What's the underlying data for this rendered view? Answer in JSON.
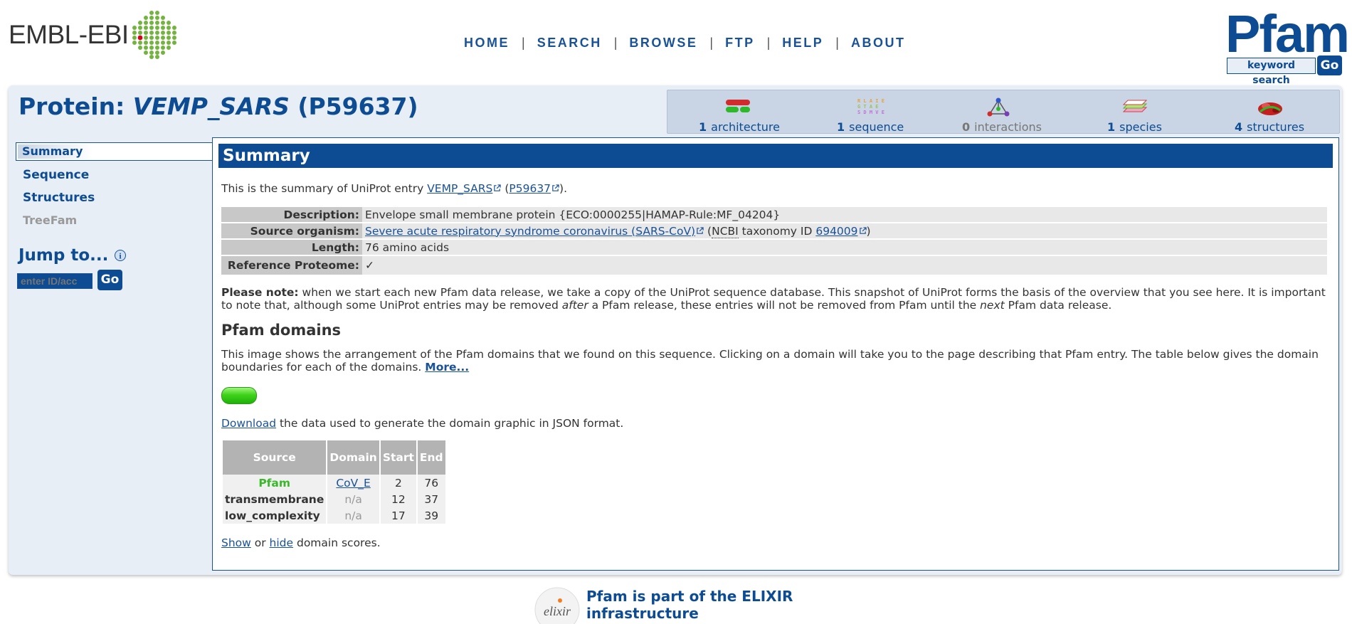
{
  "header": {
    "org_logo_text": "EMBL-EBI",
    "nav": [
      {
        "label": "HOME"
      },
      {
        "label": "SEARCH"
      },
      {
        "label": "BROWSE"
      },
      {
        "label": "FTP"
      },
      {
        "label": "HELP"
      },
      {
        "label": "ABOUT"
      }
    ],
    "nav_separator": "|",
    "site_logo": "Pfam",
    "keyword_search_label": "keyword search",
    "go_label": "Go"
  },
  "page": {
    "title_prefix": "Protein:",
    "title_id": "VEMP_SARS",
    "title_acc": "(P59637)"
  },
  "iconbar": [
    {
      "count": "1",
      "label": "architecture",
      "icon": "architecture-icon"
    },
    {
      "count": "1",
      "label": "sequence",
      "icon": "sequence-icon"
    },
    {
      "count": "0",
      "label": "interactions",
      "icon": "interactions-icon"
    },
    {
      "count": "1",
      "label": "species",
      "icon": "species-icon"
    },
    {
      "count": "4",
      "label": "structures",
      "icon": "structures-icon"
    }
  ],
  "sidebar": {
    "items": [
      {
        "label": "Summary"
      },
      {
        "label": "Sequence"
      },
      {
        "label": "Structures"
      },
      {
        "label": "TreeFam"
      }
    ],
    "jump_label": "Jump to...",
    "jump_placeholder": "enter ID/acc",
    "jump_go": "Go"
  },
  "summary": {
    "heading": "Summary",
    "intro_pre": "This is the summary of UniProt entry ",
    "intro_link1": "VEMP_SARS",
    "intro_mid": " (",
    "intro_link2": "P59637",
    "intro_post": ").",
    "rows": {
      "description_label": "Description:",
      "description_value": "Envelope small membrane protein {ECO:0000255|HAMAP-Rule:MF_04204}",
      "organism_label": "Source organism:",
      "organism_link": "Severe acute respiratory syndrome coronavirus (SARS-CoV)",
      "organism_mid1": " (",
      "organism_ncbi": "NCBI",
      "organism_mid2": " taxonomy ID ",
      "organism_taxid": "694009",
      "organism_post": ")",
      "length_label": "Length:",
      "length_value": "76 amino acids",
      "refprot_label": "Reference Proteome:",
      "refprot_value": "✓"
    },
    "note_bold": "Please note:",
    "note_1": " when we start each new Pfam data release, we take a copy of the UniProt sequence database. This snapshot of UniProt forms the basis of the overview that you see here. It is important to note that, although some UniProt entries may be removed ",
    "note_after": "after",
    "note_2": " a Pfam release, these entries will not be removed from Pfam until the ",
    "note_next": "next",
    "note_3": " Pfam data release."
  },
  "domains": {
    "heading": "Pfam domains",
    "para": "This image shows the arrangement of the Pfam domains that we found on this sequence. Clicking on a domain will take you to the page describing that Pfam entry. The table below gives the domain boundaries for each of the domains. ",
    "more": "More...",
    "download_link": "Download",
    "download_rest": " the data used to generate the domain graphic in JSON format.",
    "table_headers": [
      "Source",
      "Domain",
      "Start",
      "End"
    ],
    "rows": [
      {
        "source": "Pfam",
        "domain": "CoV_E",
        "start": "2",
        "end": "76"
      },
      {
        "source": "transmembrane",
        "domain": "n/a",
        "start": "12",
        "end": "37"
      },
      {
        "source": "low_complexity",
        "domain": "n/a",
        "start": "17",
        "end": "39"
      }
    ],
    "show": "Show",
    "or": " or ",
    "hide": "hide",
    "scores_rest": " domain scores."
  },
  "footer": {
    "elixir_logo_text": "elixir",
    "line1": "Pfam is part of the ELIXIR",
    "line2": "infrastructure"
  },
  "colors": {
    "brand_blue": "#0d4c92",
    "pfam_green": "#3bb82a",
    "panel_bg": "#e7eef6"
  }
}
